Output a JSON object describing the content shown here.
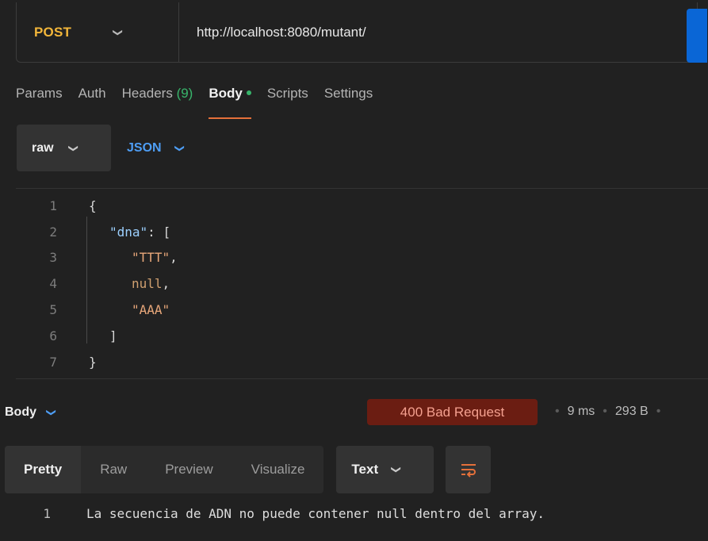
{
  "request": {
    "method": "POST",
    "url": "http://localhost:8080/mutant/",
    "tabs": [
      {
        "label": "Params"
      },
      {
        "label": "Auth"
      },
      {
        "label": "Headers",
        "count": "(9)"
      },
      {
        "label": "Body"
      },
      {
        "label": "Scripts"
      },
      {
        "label": "Settings"
      }
    ],
    "active_tab": "Body",
    "body_mode": "raw",
    "body_language": "JSON",
    "lines": [
      {
        "n": "1"
      },
      {
        "n": "2"
      },
      {
        "n": "3"
      },
      {
        "n": "4"
      },
      {
        "n": "5"
      },
      {
        "n": "6"
      },
      {
        "n": "7"
      }
    ],
    "code": {
      "open_brace": "{",
      "key": "\"dna\"",
      "colon_bracket": ": [",
      "item1": "\"TTT\"",
      "item2": "null",
      "item3": "\"AAA\"",
      "comma": ",",
      "close_bracket": "]",
      "close_brace": "}"
    }
  },
  "response": {
    "title": "Body",
    "status": "400 Bad Request",
    "time": "9 ms",
    "size": "293 B",
    "tabs": [
      {
        "label": "Pretty"
      },
      {
        "label": "Raw"
      },
      {
        "label": "Preview"
      },
      {
        "label": "Visualize"
      }
    ],
    "format": "Text",
    "line_number": "1",
    "text": "La secuencia de ADN no puede contener null dentro del array."
  },
  "colors": {
    "method": "#f2b63a",
    "accent_tab": "#e4703a",
    "count": "#38b56b",
    "json_blue": "#4e9ef5",
    "status_bg": "#6b1d12",
    "send": "#0a66d6"
  }
}
